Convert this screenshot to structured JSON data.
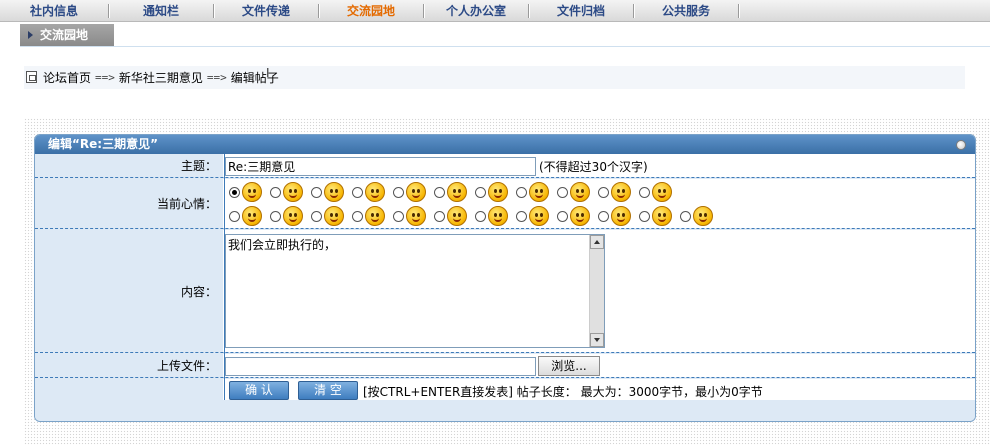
{
  "nav": {
    "items": [
      {
        "label": "社内信息",
        "active": false
      },
      {
        "label": "通知栏",
        "active": false
      },
      {
        "label": "文件传递",
        "active": false
      },
      {
        "label": "交流园地",
        "active": true
      },
      {
        "label": "个人办公室",
        "active": false
      },
      {
        "label": "文件归档",
        "active": false
      },
      {
        "label": "公共服务",
        "active": false
      }
    ],
    "active_color": "#e46a00",
    "color": "#2c4a86"
  },
  "subnav": {
    "tab_label": "交流园地"
  },
  "breadcrumb": {
    "home": "论坛首页",
    "sep1": "==>",
    "board": "新华社三期意见",
    "sep2": "==>",
    "current": "编辑帖子"
  },
  "panel": {
    "title": "编辑“Re:三期意见”",
    "subject_label": "主题：",
    "subject_value": "Re:三期意见",
    "subject_hint": "(不得超过30个汉字)",
    "mood_label": "当前心情：",
    "mood_icons": [
      "smile-icon",
      "angry-icon",
      "sad-icon",
      "cry-icon",
      "laugh-icon",
      "mad-icon",
      "shy-icon",
      "surprised-icon",
      "tongue-icon",
      "wink-icon",
      "alert-icon",
      "bored-icon",
      "evil-icon",
      "sick-icon",
      "scared-icon",
      "drool-icon",
      "grin-icon",
      "upset-icon",
      "sleepy-icon",
      "teeth-icon",
      "cool-icon",
      "sweat-icon",
      "love-icon"
    ],
    "content_label": "内容：",
    "content_value": "我们会立即执行的，",
    "upload_label": "上传文件：",
    "upload_value": "",
    "browse_label": "浏览...",
    "confirm_label": "确 认",
    "clear_label": "清 空",
    "submit_hint": "[按CTRL+ENTER直接发表] 帖子长度： 最大为：3000字节，最小为0字节"
  }
}
